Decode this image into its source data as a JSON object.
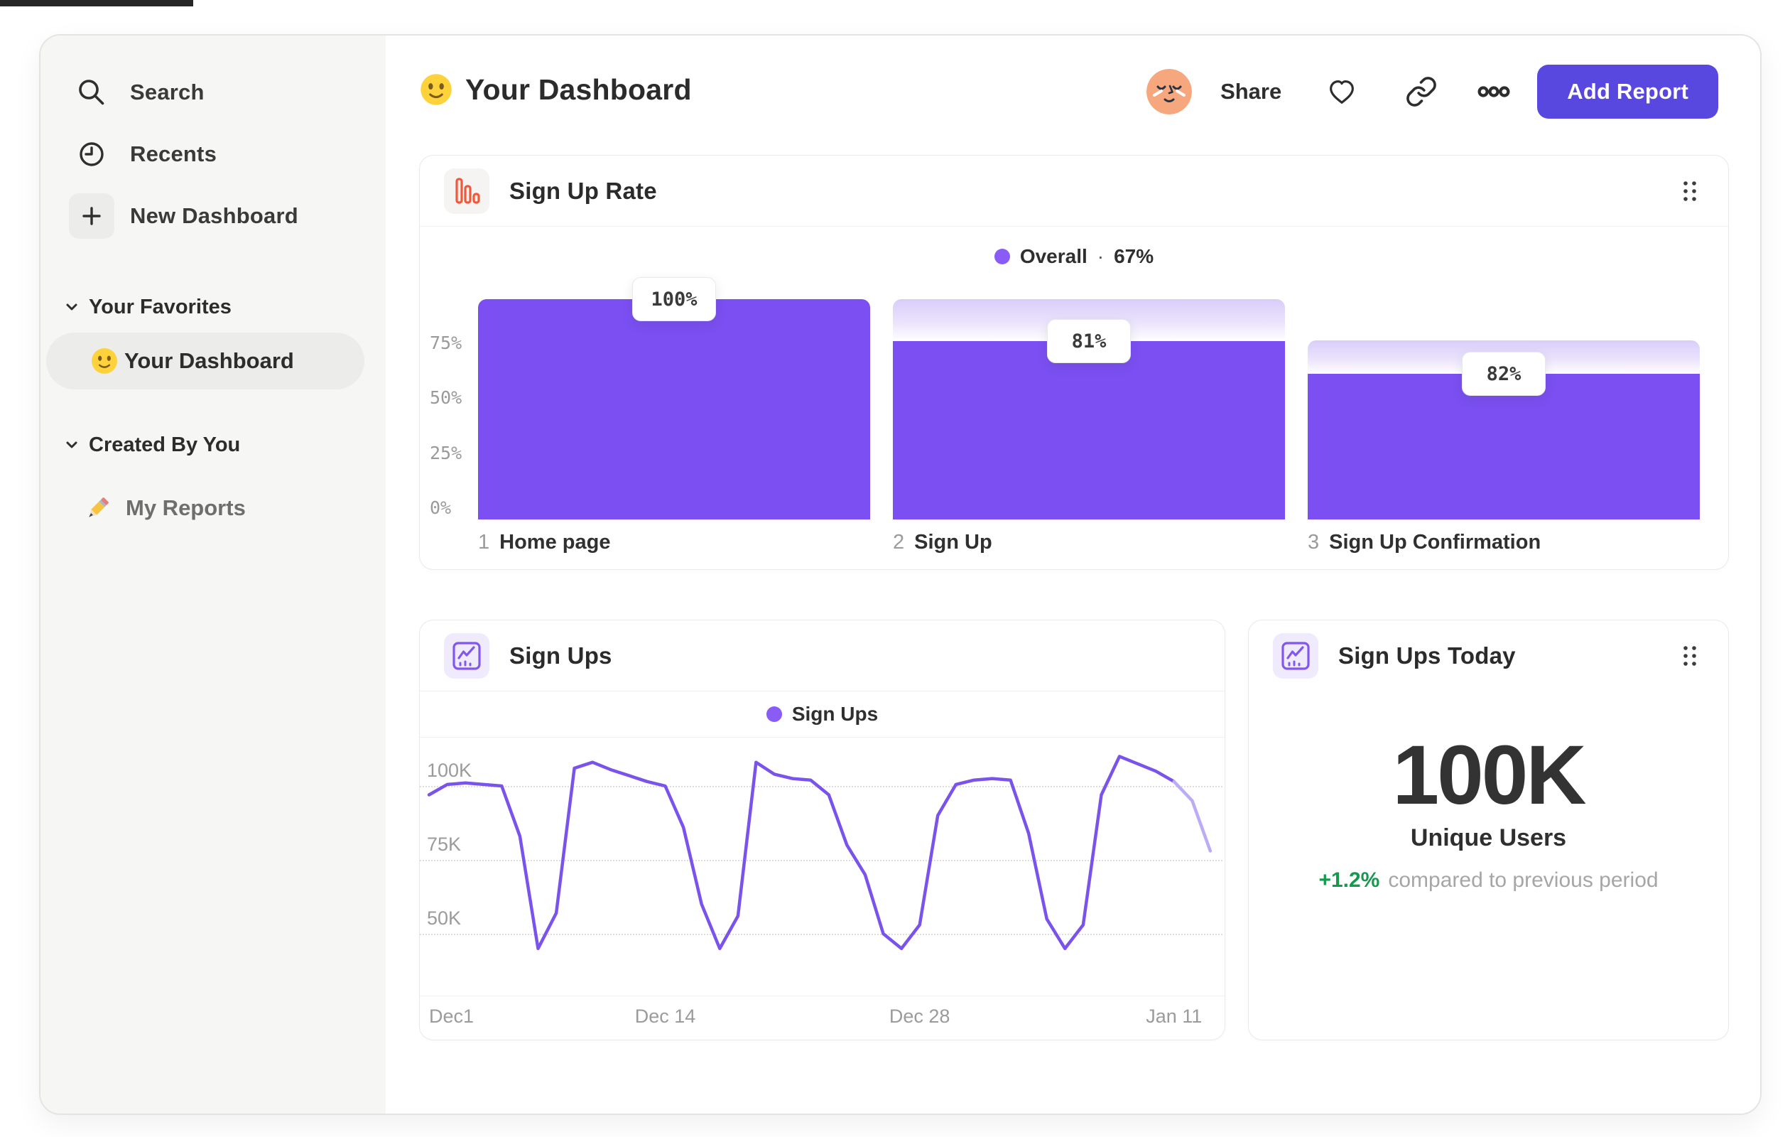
{
  "sidebar": {
    "nav": [
      {
        "label": "Search"
      },
      {
        "label": "Recents"
      },
      {
        "label": "New Dashboard"
      }
    ],
    "sections": [
      {
        "label": "Your Favorites",
        "items": [
          {
            "label": "Your Dashboard",
            "selected": true
          }
        ]
      },
      {
        "label": "Created By You",
        "items": [
          {
            "label": "My Reports",
            "selected": false
          }
        ]
      }
    ]
  },
  "header": {
    "title": "Your Dashboard",
    "share_label": "Share",
    "add_report_label": "Add Report"
  },
  "cards": {
    "stat": {
      "title": "Sign Ups Today",
      "value": "100K",
      "subtitle": "Unique Users",
      "delta": "+1.2%",
      "delta_note": "compared to previous period"
    }
  },
  "colors": {
    "funnel_bar": "#7B4FF2",
    "funnel_gradient_top": "#D8CDFA",
    "line_series": "#7A52EC",
    "line_series_faded": "#BCABF5",
    "legend_dot": "#8A5CF6",
    "add_report_button": "#5848E0",
    "card_icon_orange": "#EF583B",
    "card_icon_purple": "#8257F0",
    "delta_green": "#16994F",
    "sidebar_bg": "#F6F6F4",
    "selected_pill": "#ECECEA"
  },
  "chart_data": [
    {
      "type": "bar",
      "subtype": "funnel",
      "title": "Sign Up Rate",
      "legend": "Overall",
      "legend_separator": "·",
      "overall_rate": "67%",
      "ylim": [
        0,
        100
      ],
      "yticks": [
        {
          "label": "75%",
          "pct": 75
        },
        {
          "label": "50%",
          "pct": 50
        },
        {
          "label": "25%",
          "pct": 25
        },
        {
          "label": "0%",
          "pct": 0
        }
      ],
      "steps": [
        {
          "index": "1",
          "label": "Home page",
          "chip": "100%",
          "conversion_from_previous_pct": 100,
          "cumulative_pct": 100
        },
        {
          "index": "2",
          "label": "Sign Up",
          "chip": "81%",
          "conversion_from_previous_pct": 81,
          "cumulative_pct": 81
        },
        {
          "index": "3",
          "label": "Sign Up Confirmation",
          "chip": "82%",
          "conversion_from_previous_pct": 82,
          "cumulative_pct": 66
        }
      ]
    },
    {
      "type": "line",
      "title": "Sign Ups",
      "legend": "Sign Ups",
      "unit": "K",
      "grid": "dotted-horizontal",
      "yticks": [
        {
          "label": "100K",
          "value": 100
        },
        {
          "label": "75K",
          "value": 75
        },
        {
          "label": "50K",
          "value": 50
        }
      ],
      "xticks": [
        {
          "label": "Dec1",
          "day": 0
        },
        {
          "label": "Dec 14",
          "day": 13
        },
        {
          "label": "Dec 28",
          "day": 27
        },
        {
          "label": "Jan 11",
          "day": 41
        }
      ],
      "values_k": [
        97,
        100.5,
        101,
        100.5,
        100,
        83,
        45,
        57,
        106,
        108,
        105.5,
        103.5,
        101.5,
        100,
        86,
        60,
        45,
        56,
        108,
        104,
        102.5,
        102,
        97,
        80,
        70,
        50,
        45,
        53,
        90,
        100.5,
        102,
        102.5,
        102,
        84,
        55,
        45,
        53,
        97,
        110,
        107.5,
        105,
        101.5,
        95,
        78
      ],
      "faded_from_index": 41
    }
  ]
}
